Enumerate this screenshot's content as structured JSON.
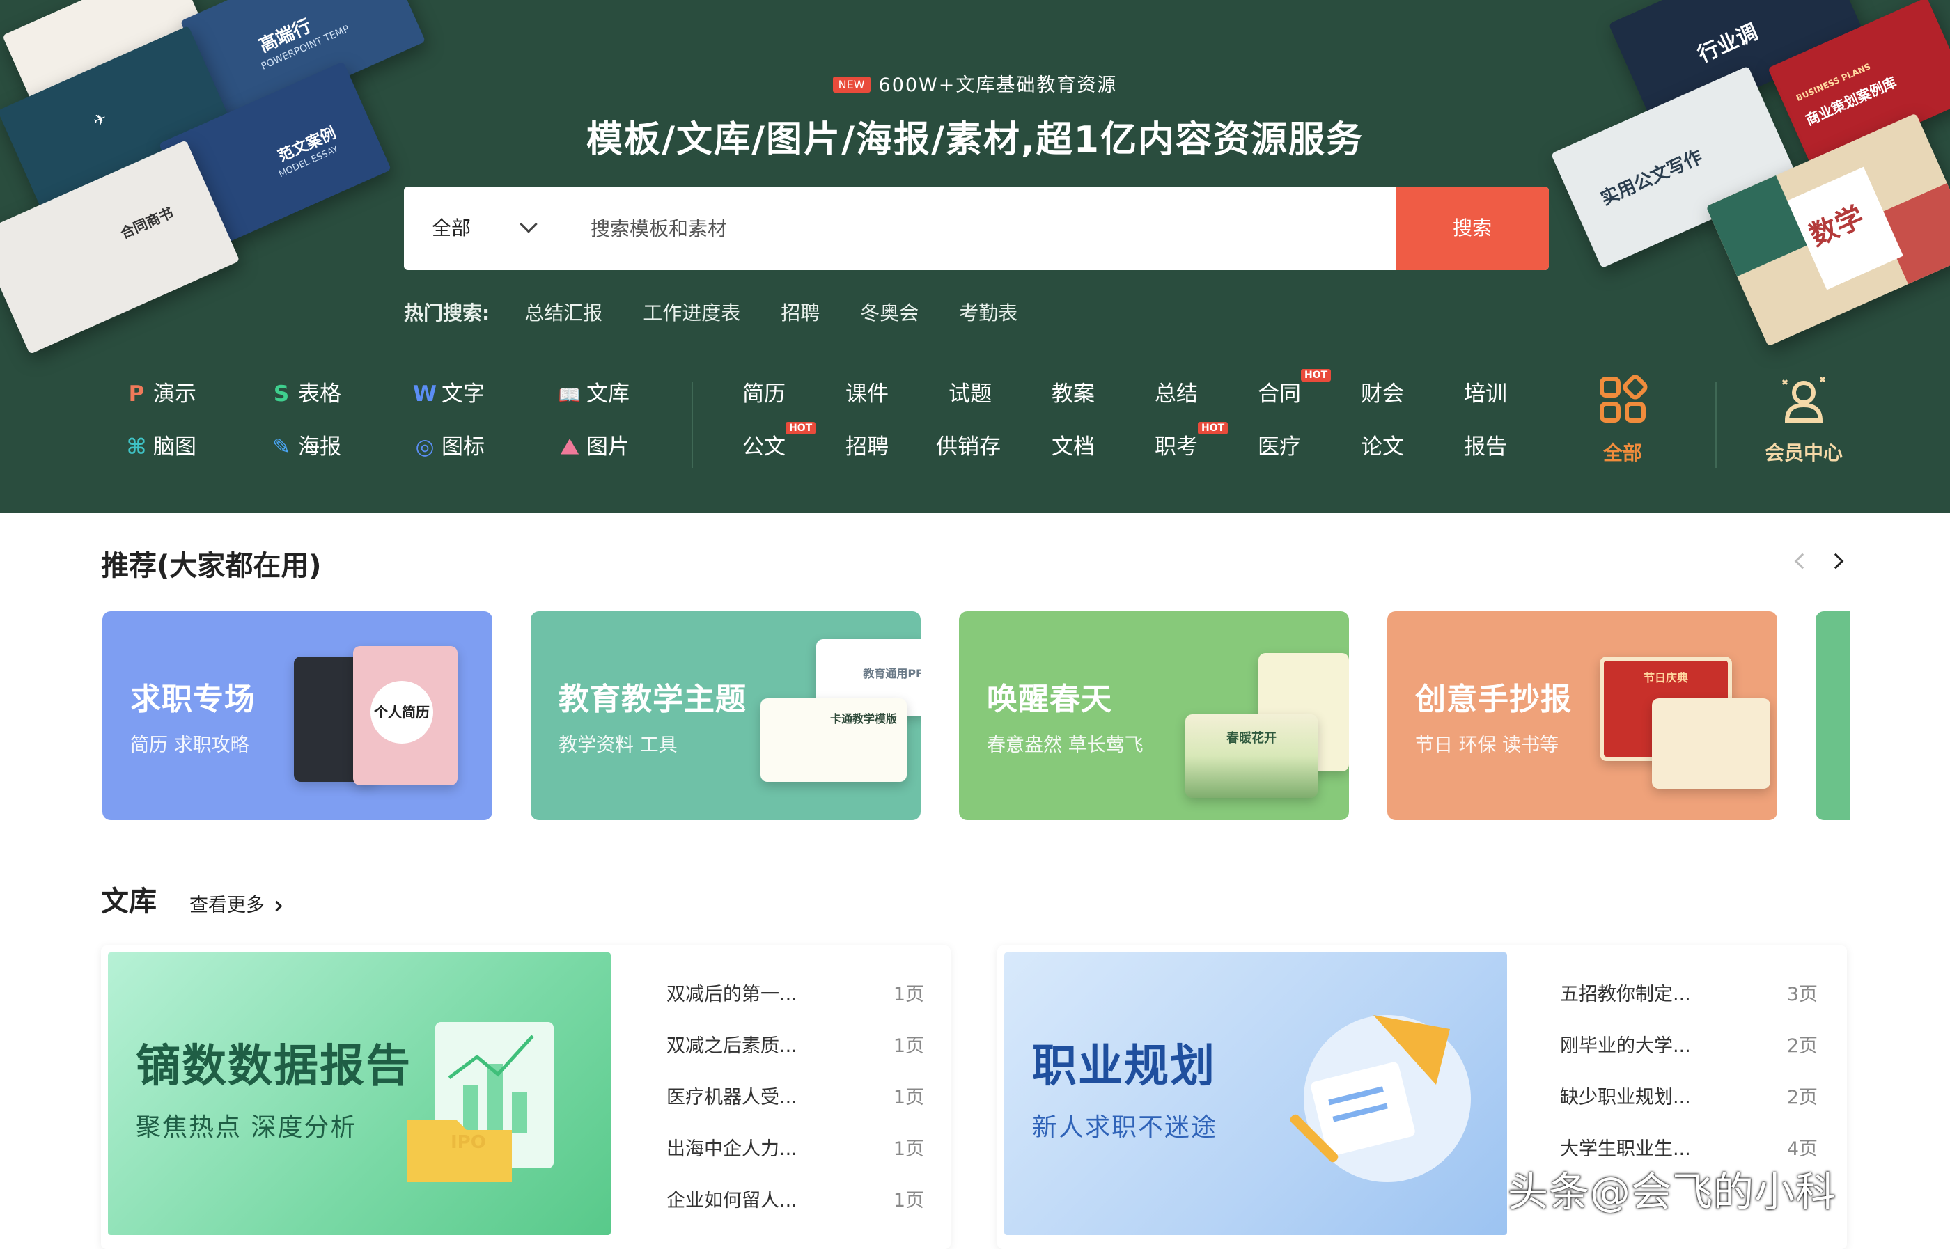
{
  "hero": {
    "badge": "NEW",
    "top_line": "600W+文库基础教育资源",
    "title": "模板/文库/图片/海报/素材,超1亿内容资源服务",
    "decor": {
      "a": "高端行",
      "b": "POWERPOINT TEMP",
      "c": "范文案例",
      "d": "MODEL ESSAY",
      "e": "合同商书",
      "f": "行业调",
      "g": "商业策划案例库",
      "h": "BUSINESS PLANS",
      "i": "实用公文写作",
      "j": "数学"
    }
  },
  "search": {
    "category": "全部",
    "placeholder": "搜索模板和素材",
    "button": "搜索"
  },
  "hot_search": {
    "label": "热门搜索:",
    "items": [
      "总结汇报",
      "工作进度表",
      "招聘",
      "冬奥会",
      "考勤表"
    ]
  },
  "nav": {
    "tools": [
      {
        "icon": "P",
        "label": "演示"
      },
      {
        "icon": "S",
        "label": "表格"
      },
      {
        "icon": "W",
        "label": "文字"
      },
      {
        "icon": "📖",
        "label": "文库"
      },
      {
        "icon": "⌘",
        "label": "脑图"
      },
      {
        "icon": "✎",
        "label": "海报"
      },
      {
        "icon": "◎",
        "label": "图标"
      },
      {
        "icon": "⛰",
        "label": "图片"
      }
    ],
    "hot_badge": "HOT",
    "categories_row1": [
      "简历",
      "课件",
      "试题",
      "教案",
      "总结",
      "合同",
      "财会",
      "培训"
    ],
    "categories_row2": [
      "公文",
      "招聘",
      "供销存",
      "文档",
      "职考",
      "医疗",
      "论文",
      "报告"
    ],
    "all_label": "全部",
    "member_label": "会员中心",
    "colors": {
      "accent_orange": "#f08c3c",
      "hot_red": "#e94b3b"
    }
  },
  "recommend": {
    "title": "推荐(大家都在用)",
    "cards": [
      {
        "title": "求职专场",
        "subtitle": "简历 求职攻略",
        "thumb_text": "个人简历",
        "color": "#7e9ef2"
      },
      {
        "title": "教育教学主题",
        "subtitle": "教学资料 工具",
        "thumb_text": "卡通教学模版",
        "thumb_text2": "教育通用PF",
        "color": "#6fc1a7"
      },
      {
        "title": "唤醒春天",
        "subtitle": "春意盎然 草长莺飞",
        "thumb_text": "春暖花开",
        "color": "#87c97a"
      },
      {
        "title": "创意手抄报",
        "subtitle": "节日 环保 读书等",
        "thumb_text": "节日庆典",
        "color": "#efa27a"
      }
    ]
  },
  "library": {
    "title": "文库",
    "more": "查看更多",
    "panels": [
      {
        "banner_title": "镝数数据报告",
        "banner_subtitle": "聚焦热点 深度分析",
        "banner_tag": "IPO",
        "items": [
          {
            "name": "双减后的第一...",
            "pages": "1页"
          },
          {
            "name": "双减之后素质...",
            "pages": "1页"
          },
          {
            "name": "医疗机器人受...",
            "pages": "1页"
          },
          {
            "name": "出海中企人力...",
            "pages": "1页"
          },
          {
            "name": "企业如何留人...",
            "pages": "1页"
          }
        ]
      },
      {
        "banner_title": "职业规划",
        "banner_subtitle": "新人求职不迷途",
        "items": [
          {
            "name": "五招教你制定...",
            "pages": "3页"
          },
          {
            "name": "刚毕业的大学...",
            "pages": "2页"
          },
          {
            "name": "缺少职业规划...",
            "pages": "2页"
          },
          {
            "name": "大学生职业生...",
            "pages": "4页"
          }
        ]
      }
    ]
  },
  "watermark": "头条@会飞的小科"
}
